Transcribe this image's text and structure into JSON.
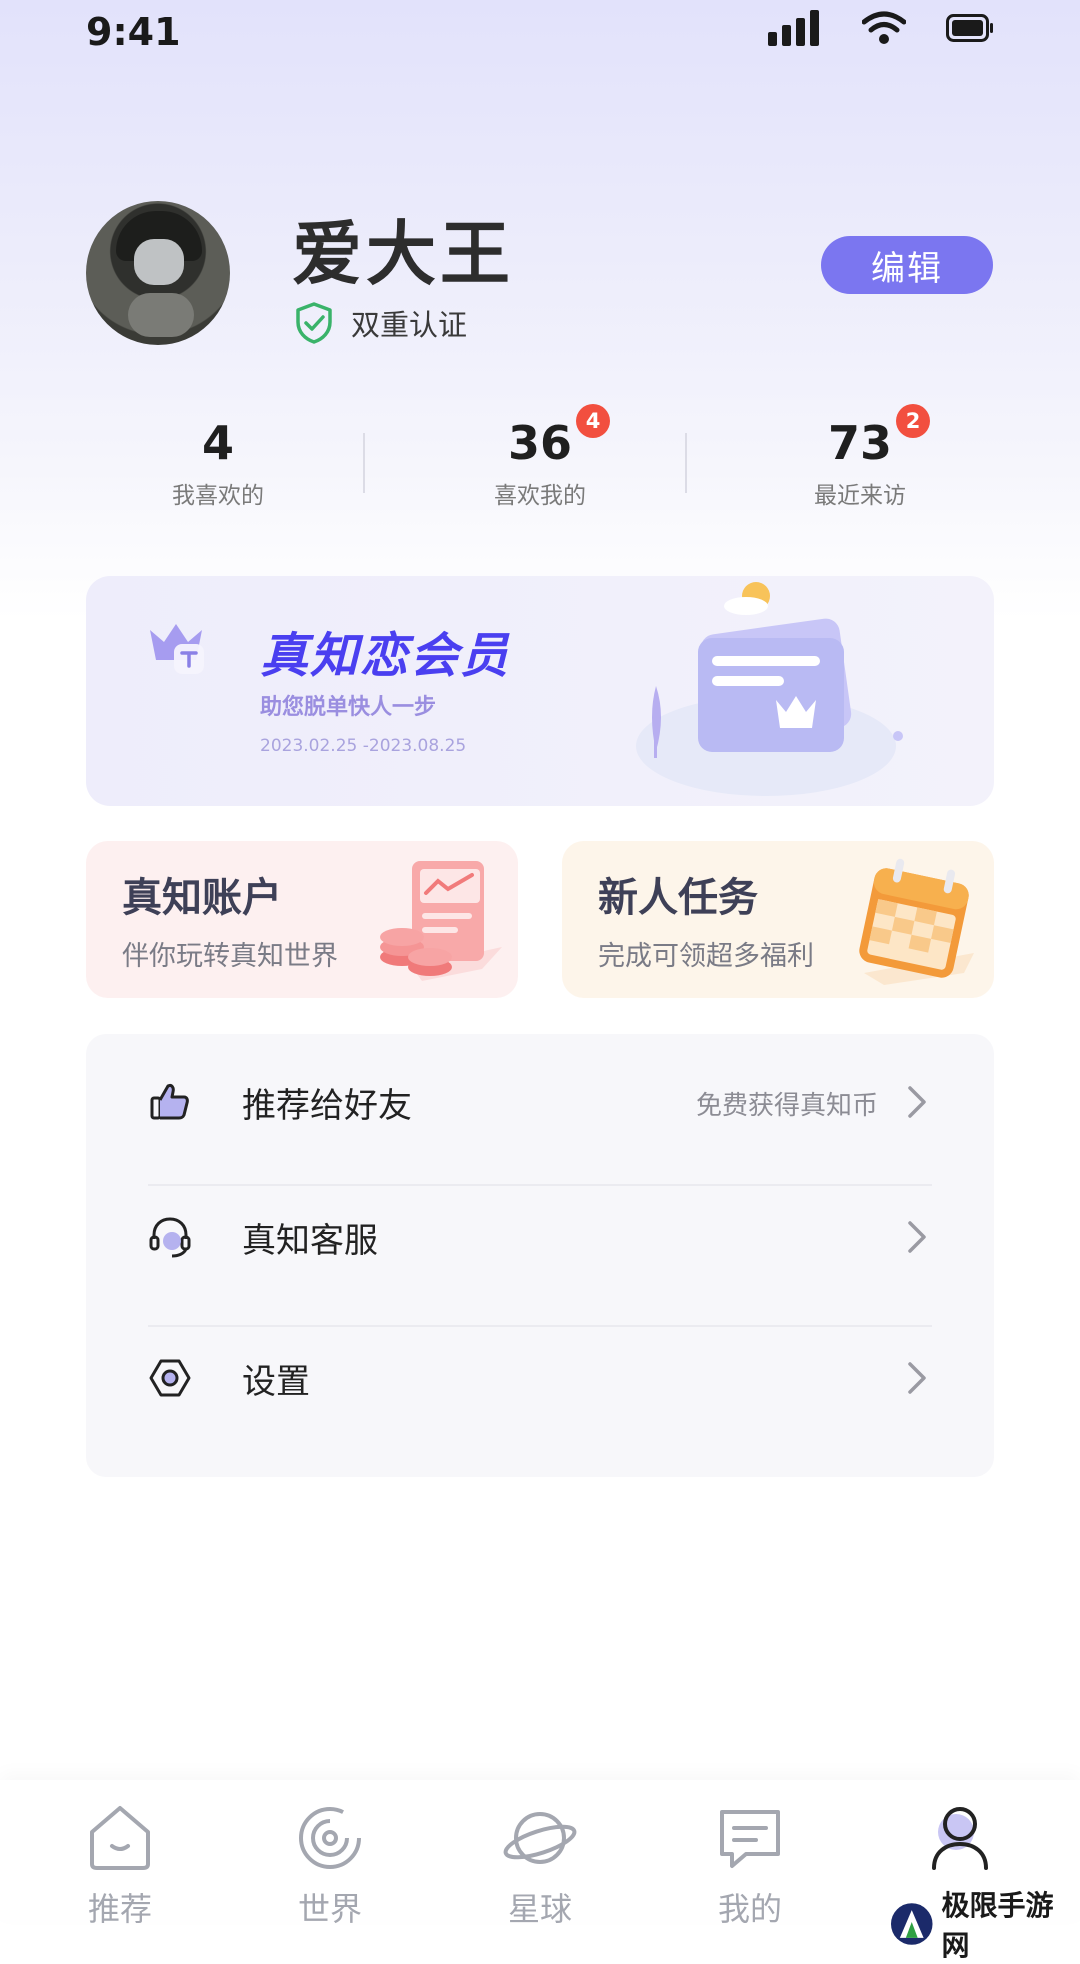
{
  "status_bar": {
    "time": "9:41"
  },
  "profile": {
    "name": "爱大王",
    "verification": "双重认证",
    "edit_label": "编辑"
  },
  "stats": [
    {
      "value": "4",
      "label": "我喜欢的",
      "badge": ""
    },
    {
      "value": "36",
      "label": "喜欢我的",
      "badge": "4"
    },
    {
      "value": "73",
      "label": "最近来访",
      "badge": "2"
    }
  ],
  "vip": {
    "title": "真知恋会员",
    "subtitle": "助您脱单快人一步",
    "date_range": "2023.02.25 -2023.08.25"
  },
  "cards": [
    {
      "title": "真知账户",
      "subtitle": "伴你玩转真知世界"
    },
    {
      "title": "新人任务",
      "subtitle": "完成可领超多福利"
    }
  ],
  "menu": [
    {
      "label": "推荐给好友",
      "hint": "免费获得真知币",
      "icon": "thumbs-up-icon"
    },
    {
      "label": "真知客服",
      "hint": "",
      "icon": "headset-icon"
    },
    {
      "label": "设置",
      "hint": "",
      "icon": "settings-hexagon-icon"
    }
  ],
  "tabs": [
    {
      "label": "推荐",
      "icon": "home-icon"
    },
    {
      "label": "世界",
      "icon": "spiral-icon"
    },
    {
      "label": "星球",
      "icon": "planet-icon"
    },
    {
      "label": "我的",
      "icon": "message-icon"
    },
    {
      "label": "",
      "icon": "profile-icon"
    }
  ],
  "watermark": {
    "text": "极限手游网"
  },
  "colors": {
    "accent": "#7b76f0",
    "badge": "#f24f3f",
    "vip_title": "#4a3ff0",
    "verify_green": "#3ab36a"
  }
}
